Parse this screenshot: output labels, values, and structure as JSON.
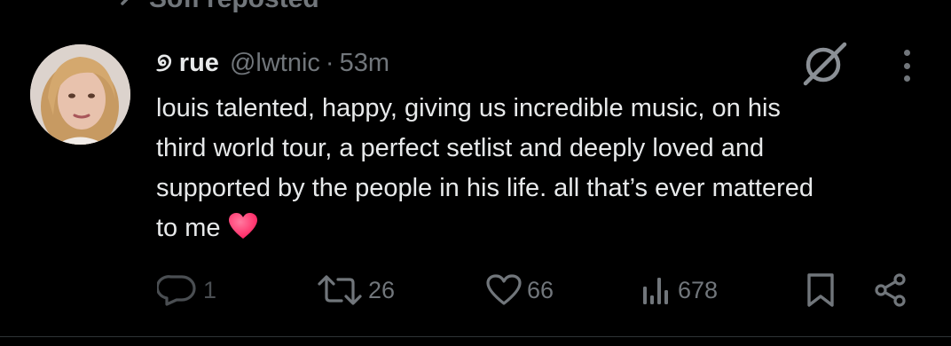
{
  "repost_bar": {
    "icon": "repost-icon",
    "text": "Sofi reposted"
  },
  "tweet": {
    "display_name": "୭ rue",
    "handle": "@lwtnic",
    "separator": "·",
    "time": "53m",
    "text": "louis talented, happy, giving us incredible music, on his\nthird world tour, a perfect setlist and deeply loved and\nsupported by the people in his life. all that’s ever mattered\nto me",
    "trailing_emoji": "heart-emoji",
    "avatar_icon": "avatar",
    "grok_icon": "grok-icon",
    "more_icon": "more-icon"
  },
  "actions": {
    "reply": {
      "icon": "reply-icon",
      "count": "1"
    },
    "repost": {
      "icon": "repost-icon",
      "count": "26"
    },
    "like": {
      "icon": "heart-icon",
      "count": "66"
    },
    "views": {
      "icon": "views-icon",
      "count": "678"
    },
    "bookmark": {
      "icon": "bookmark-icon"
    },
    "share": {
      "icon": "share-icon"
    }
  },
  "colors": {
    "background": "#000000",
    "primary_text": "#e7e9ea",
    "secondary_text": "#71767b",
    "heart": "#ff2d6b"
  }
}
